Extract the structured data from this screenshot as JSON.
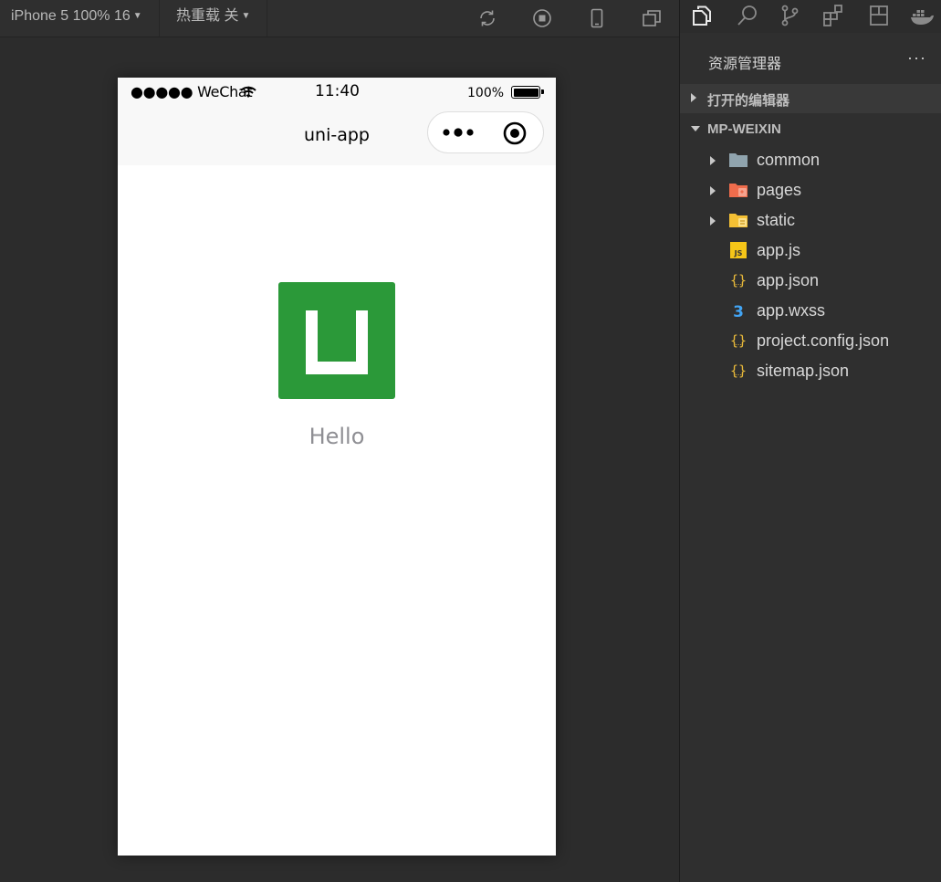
{
  "toolbar": {
    "device": "iPhone 5 100% 16",
    "hot_reload": "热重载 关"
  },
  "phone": {
    "carrier": "●●●●● WeChat",
    "time": "11:40",
    "battery_pct": "100%",
    "nav_title": "uni-app",
    "hello_text": "Hello",
    "logo_color": "#2b9939"
  },
  "explorer": {
    "title": "资源管理器",
    "more": "···",
    "open_editors": "打开的编辑器",
    "project": "MP-WEIXIN",
    "items": [
      {
        "name": "common",
        "icon": "folder-icon"
      },
      {
        "name": "pages",
        "icon": "pages-folder-icon"
      },
      {
        "name": "static",
        "icon": "static-folder-icon"
      },
      {
        "name": "app.js",
        "icon": "js-file-icon"
      },
      {
        "name": "app.json",
        "icon": "json-file-icon"
      },
      {
        "name": "app.wxss",
        "icon": "css-file-icon"
      },
      {
        "name": "project.config.json",
        "icon": "json-file-icon"
      },
      {
        "name": "sitemap.json",
        "icon": "json-file-icon"
      }
    ]
  },
  "colors": {
    "folder_gray": "#90a4ae",
    "folder_red": "#ef6c4c",
    "folder_yellow": "#f4c034",
    "js_yellow": "#f5c518",
    "json_yellow": "#e8b93a",
    "css_blue": "#42a5f5"
  }
}
